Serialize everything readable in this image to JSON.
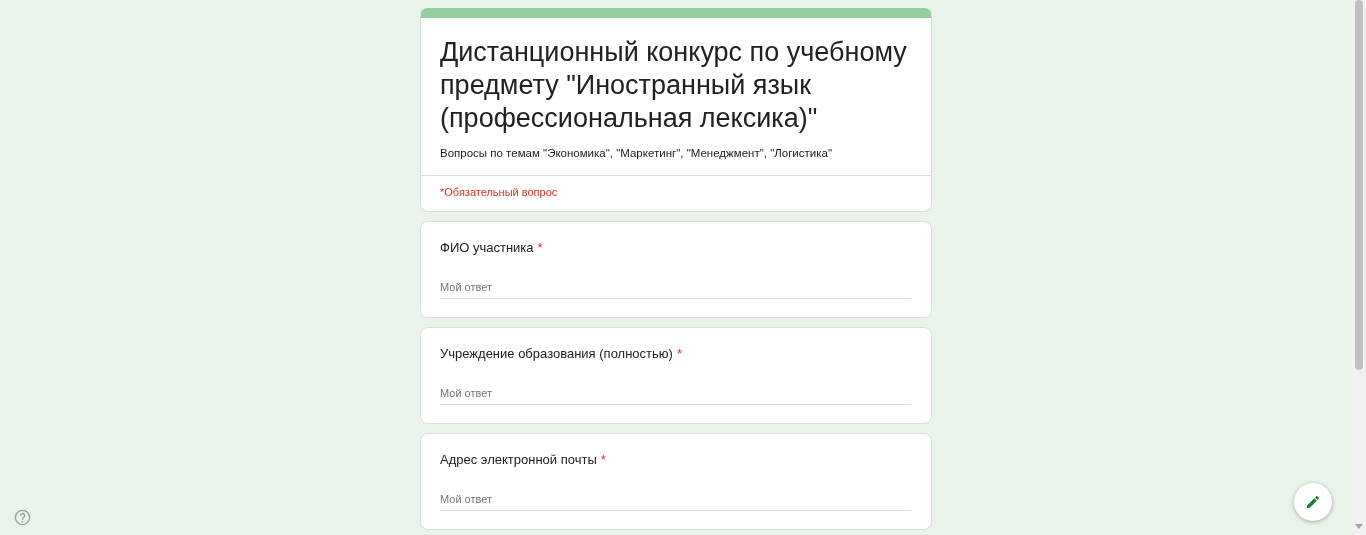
{
  "form": {
    "title": "Дистанционный конкурс по учебному предмету \"Иностранный язык (профессиональная лексика)\"",
    "description": "Вопросы по темам \"Экономика\", \"Маркетинг\", \"Менеджмент\", \"Логистика\"",
    "required_note": "*Обязательный вопрос"
  },
  "questions": [
    {
      "label": "ФИО участника",
      "required_mark": "*",
      "placeholder": "Мой ответ"
    },
    {
      "label": "Учреждение образования (полностью)",
      "required_mark": "*",
      "placeholder": "Мой ответ"
    },
    {
      "label": "Адрес электронной почты ",
      "required_mark": "*",
      "placeholder": "Мой ответ"
    }
  ]
}
